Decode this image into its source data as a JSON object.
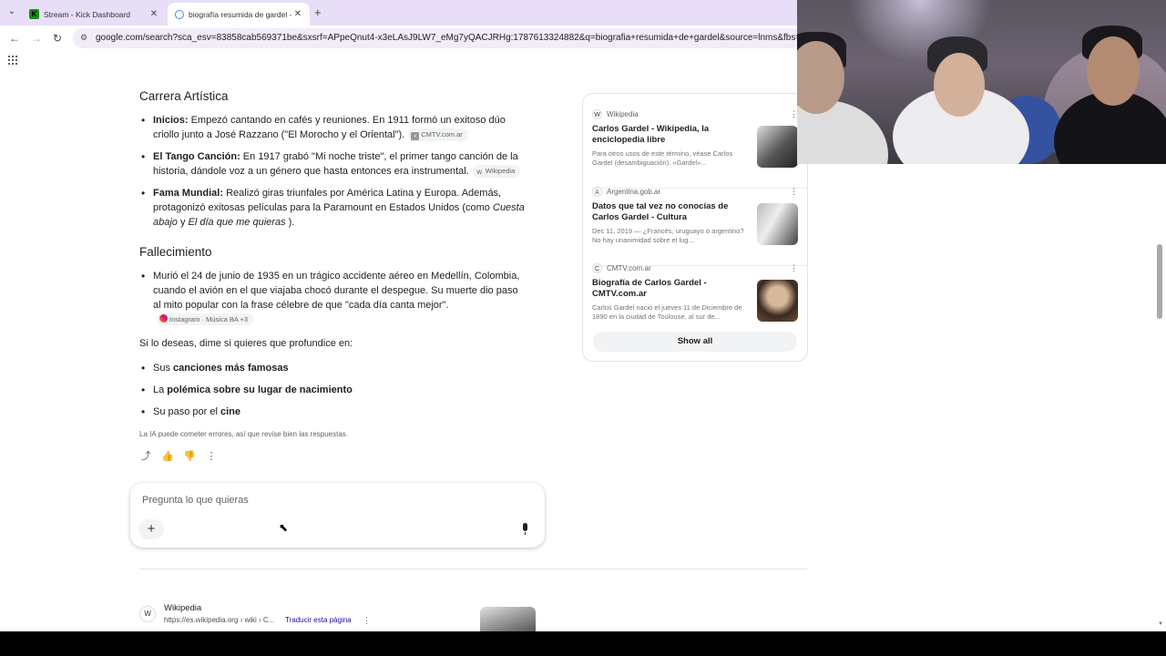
{
  "browser": {
    "tabs": [
      {
        "title": "Stream - Kick Dashboard",
        "favicon_text": "K"
      },
      {
        "title": "biografía resumida de gardel -"
      }
    ],
    "url": "google.com/search?sca_esv=83858cab569371be&sxsrf=APpeQnut4-x3eLAsJ9LW7_eMg7yQACJRHg:1787613324882&q=biografia+resumida+de+gardel&source=lnms&fbs=ABfTbFVyMZ"
  },
  "overview": {
    "section1": {
      "heading": "Carrera Artística",
      "items": [
        {
          "bold": "Inicios:",
          "text": " Empezó cantando en cafés y reuniones. En 1911 formó un exitoso dúo criollo junto a José Razzano (\"El Morocho y el Oriental\").",
          "chip": "CMTV.com.ar"
        },
        {
          "bold": "El Tango Canción:",
          "text": " En 1917 grabó \"Mi noche triste\", el primer tango canción de la historia, dándole voz a un género que hasta entonces era instrumental.",
          "chip": "Wikipedia"
        },
        {
          "bold": "Fama Mundial:",
          "text": " Realizó giras triunfales por América Latina y Europa. Además, protagonizó exitosas películas para la Paramount en Estados Unidos (como ",
          "ital1": "Cuesta abajo",
          "mid": " y ",
          "ital2": "El día que me quieras",
          "end": " )."
        }
      ]
    },
    "section2": {
      "heading": "Fallecimiento",
      "item": "Murió el 24 de junio de 1935 en un trágico accidente aéreo en Medellín, Colombia, cuando el avión en el que viajaba chocó durante el despegue. Su muerte dio paso al mito popular con la frase célebre de que \"cada día canta mejor\".",
      "chip": "Instagram · Música BA +3"
    },
    "followup_intro": "Si lo deseas, dime si quieres que profundice en:",
    "followups": [
      {
        "pre": "Sus ",
        "bold": "canciones más famosas"
      },
      {
        "pre": "La ",
        "bold": "polémica sobre su lugar de nacimiento"
      },
      {
        "pre": "Su paso por el ",
        "bold": "cine"
      }
    ],
    "disclaimer": "La IA puede cometer errores, así que revise bien las respuestas."
  },
  "ask": {
    "placeholder": "Pregunta lo que quieras"
  },
  "sources": {
    "cards": [
      {
        "site": "Wikipedia",
        "icon": "W",
        "title": "Carlos Gardel - Wikipedia, la enciclopedia libre",
        "snippet": "Para otros usos de este término, véase Carlos Gardel (desambiguación). «Gardel»..."
      },
      {
        "site": "Argentina.gob.ar",
        "icon": "A",
        "title": "Datos que tal vez no conocías de Carlos Gardel - Cultura",
        "snippet": "Dec 11, 2019 — ¿Francés, uruguayo o argentino? No hay unanimidad sobre el lug..."
      },
      {
        "site": "CMTV.com.ar",
        "icon": "C",
        "title": "Biografía de Carlos Gardel - CMTV.com.ar",
        "snippet": "Carlos Gardel nació el jueves 11 de Diciembre de 1890 en la ciudad de Toulouse, al sur de..."
      }
    ],
    "show_all": "Show all"
  },
  "result": {
    "site": "Wikipedia",
    "url": "https://es.wikipedia.org › wiki › C...",
    "translate": "Traducir esta página"
  }
}
